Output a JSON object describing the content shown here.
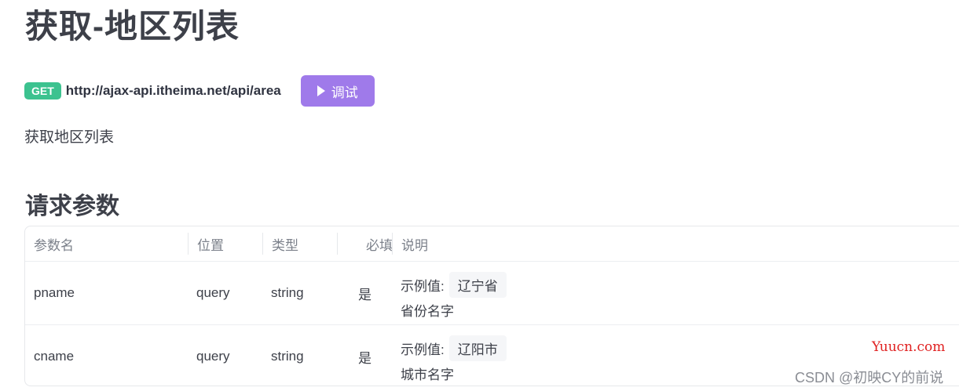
{
  "page": {
    "title": "获取-地区列表",
    "description": "获取地区列表"
  },
  "endpoint": {
    "method": "GET",
    "url": "http://ajax-api.itheima.net/api/area",
    "debug_label": "调试"
  },
  "params_section": {
    "title": "请求参数",
    "headers": {
      "name": "参数名",
      "position": "位置",
      "type": "类型",
      "required": "必填",
      "desc": "说明"
    },
    "rows": [
      {
        "name": "pname",
        "position": "query",
        "type": "string",
        "required": "是",
        "example_label": "示例值:",
        "example_value": "辽宁省",
        "desc": "省份名字"
      },
      {
        "name": "cname",
        "position": "query",
        "type": "string",
        "required": "是",
        "example_label": "示例值:",
        "example_value": "辽阳市",
        "desc": "城市名字"
      }
    ]
  },
  "watermarks": {
    "brand": "Yuucn.com",
    "csdn": "CSDN @初映CY的前说"
  },
  "colors": {
    "get_badge": "#3cc28f",
    "debug_button": "#9f7aea",
    "brand_watermark": "#e02020"
  }
}
